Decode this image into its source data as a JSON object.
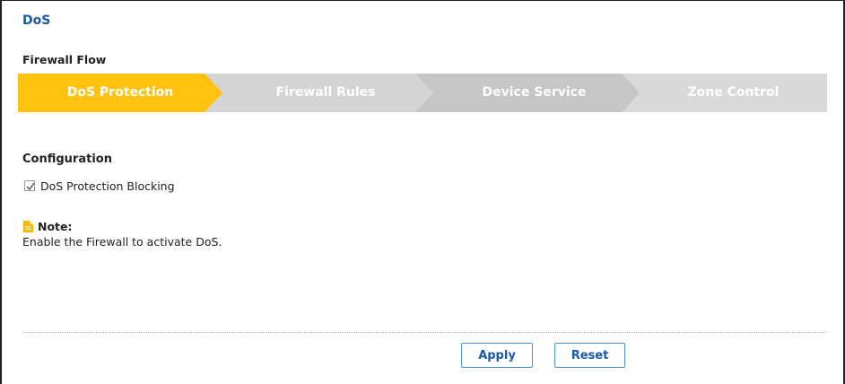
{
  "page": {
    "title": "DoS"
  },
  "flow": {
    "title": "Firewall Flow",
    "steps": [
      {
        "label": "DoS Protection",
        "active": true
      },
      {
        "label": "Firewall Rules",
        "active": false
      },
      {
        "label": "Device Service",
        "active": false
      },
      {
        "label": "Zone Control",
        "active": false
      }
    ],
    "colors": {
      "active": "#ffc20e",
      "step_fill_1": "#d4d4d4",
      "step_fill_2": "#c6c6c6",
      "step_fill_3": "#d9d9d9"
    }
  },
  "configuration": {
    "title": "Configuration",
    "dos_blocking": {
      "label": "DoS Protection Blocking",
      "checked": true
    }
  },
  "note": {
    "icon": "note-icon",
    "title": "Note:",
    "text": "Enable the Firewall to activate DoS."
  },
  "buttons": {
    "apply": "Apply",
    "reset": "Reset"
  }
}
